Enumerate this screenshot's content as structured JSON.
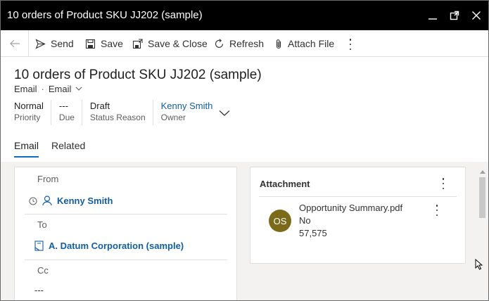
{
  "window": {
    "title": "10 orders of Product SKU JJ202 (sample)"
  },
  "commands": {
    "send": "Send",
    "save": "Save",
    "save_close": "Save & Close",
    "refresh": "Refresh",
    "attach_file": "Attach File"
  },
  "header": {
    "title": "10 orders of Product SKU JJ202 (sample)",
    "entity": "Email",
    "form_selector": "Email",
    "fields": [
      {
        "value": "Normal",
        "label": "Priority"
      },
      {
        "value": "---",
        "label": "Due"
      },
      {
        "value": "Draft",
        "label": "Status Reason"
      },
      {
        "value": "Kenny Smith",
        "label": "Owner"
      }
    ]
  },
  "tabs": [
    {
      "label": "Email",
      "active": true
    },
    {
      "label": "Related",
      "active": false
    }
  ],
  "email_form": {
    "from_label": "From",
    "from_value": "Kenny Smith",
    "to_label": "To",
    "to_value": "A. Datum Corporation (sample)",
    "cc_label": "Cc",
    "cc_value": "---"
  },
  "attachment": {
    "section_title": "Attachment",
    "initials": "OS",
    "file_name": "Opportunity Summary.pdf",
    "flag": "No",
    "size": "57,575",
    "avatar_color": "#7a6a1a"
  },
  "colors": {
    "accent": "#0f6cbd",
    "link": "#115ea3",
    "titlebar": "#000000"
  }
}
